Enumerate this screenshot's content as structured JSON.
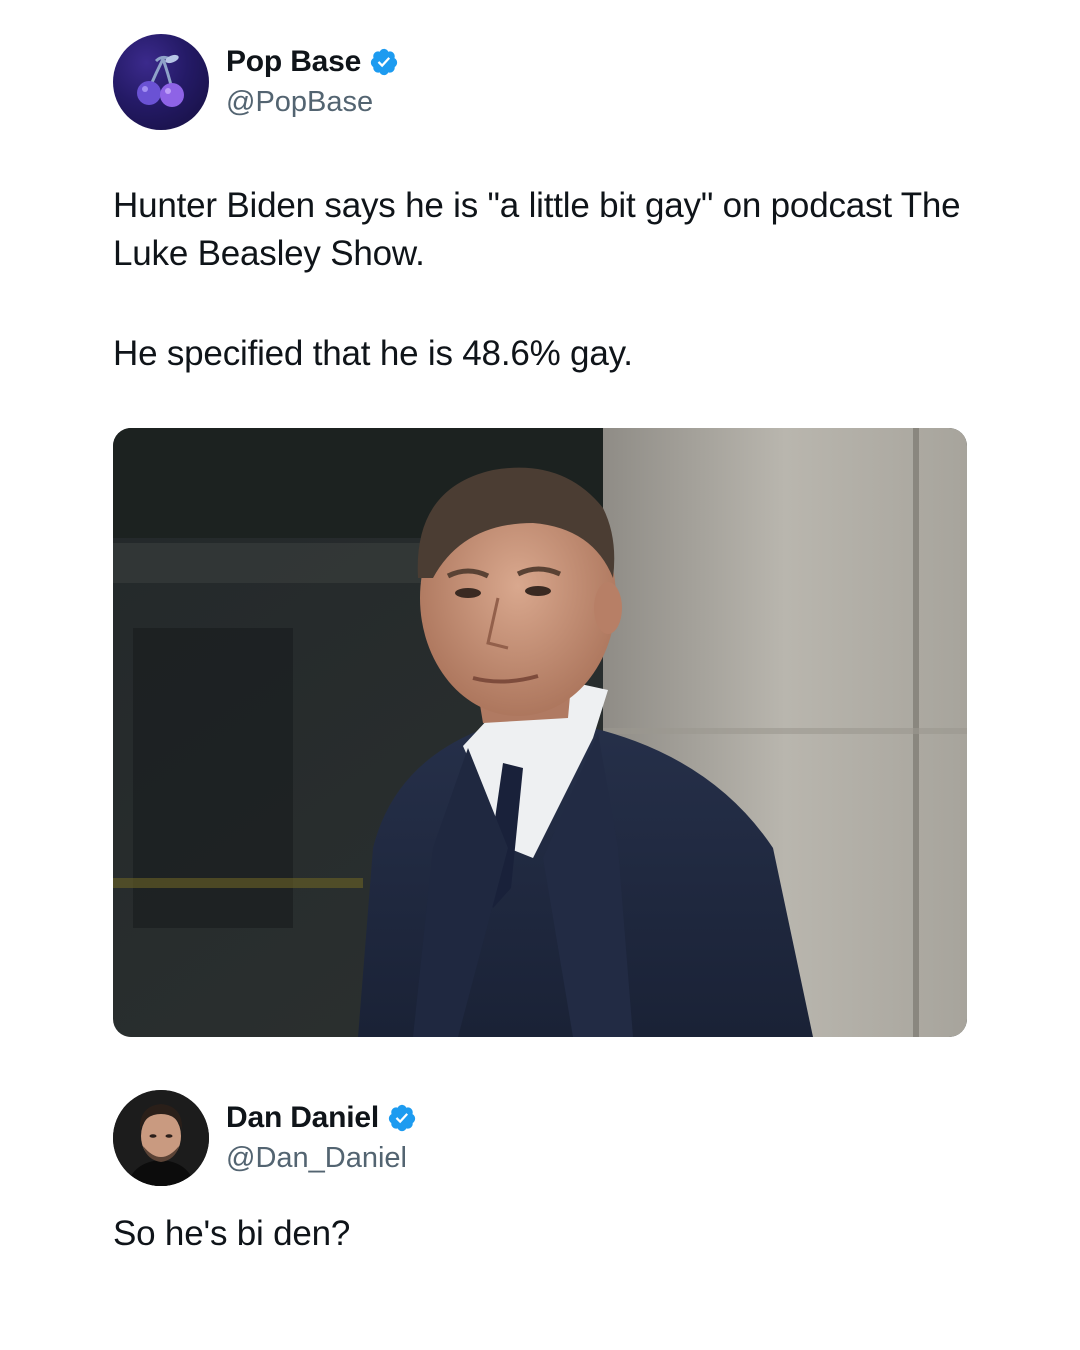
{
  "tweet1": {
    "author": {
      "name": "Pop Base",
      "handle": "@PopBase",
      "verified": true
    },
    "paragraphs": [
      "Hunter Biden says he is \"a little bit gay\" on podcast The Luke Beasley Show.",
      "He specified that he is 48.6% gay."
    ],
    "media": {
      "type": "photo",
      "subject": "man in navy suit"
    }
  },
  "tweet2": {
    "author": {
      "name": "Dan Daniel",
      "handle": "@Dan_Daniel",
      "verified": true
    },
    "text": "So he's bi den?"
  },
  "colors": {
    "text": "#0f1419",
    "handle": "#536471",
    "verified": "#1d9bf0",
    "background": "#ffffff"
  },
  "icons": {
    "pop_base_avatar": "cherry-icon",
    "verified_badge": "verified-badge-icon"
  }
}
